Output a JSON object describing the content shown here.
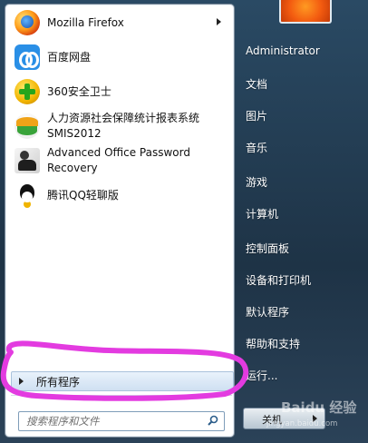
{
  "programs": [
    {
      "label": "Mozilla Firefox",
      "icon": "firefox-icon",
      "has_submenu": true
    },
    {
      "label": "百度网盘",
      "icon": "baidu-netdisk-icon"
    },
    {
      "label": "360安全卫士",
      "icon": "360-security-icon"
    },
    {
      "label_line1": "人力资源社会保障统计报表系统",
      "label_line2": "SMIS2012",
      "icon": "smis-icon"
    },
    {
      "label_line1": "Advanced Office Password",
      "label_line2": "Recovery",
      "icon": "password-recovery-icon"
    },
    {
      "label": "腾讯QQ轻聊版",
      "icon": "qq-icon"
    }
  ],
  "all_programs_label": "所有程序",
  "search": {
    "placeholder": "搜索程序和文件"
  },
  "right_panel": {
    "user": "Administrator",
    "items": [
      "文档",
      "图片",
      "音乐",
      "游戏",
      "计算机",
      "控制面板",
      "设备和打印机",
      "默认程序",
      "帮助和支持",
      "运行..."
    ]
  },
  "shutdown_label": "关机",
  "watermark": {
    "line1": "Baidu 经验",
    "line2": "jingyan.baidu.com"
  },
  "colors": {
    "annotation": "#e33be0",
    "taskbar_blue": "#22384a"
  }
}
